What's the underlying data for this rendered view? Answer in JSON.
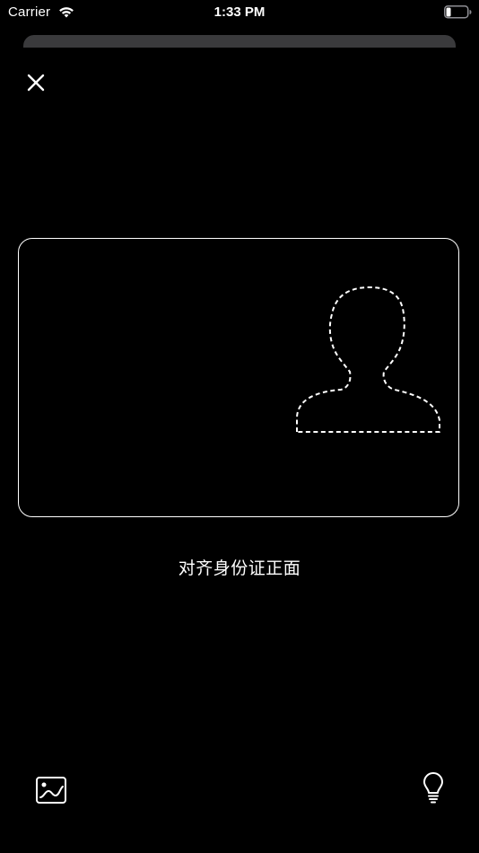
{
  "status_bar": {
    "carrier": "Carrier",
    "time": "1:33 PM",
    "wifi_icon": "wifi-icon",
    "battery_icon": "battery-icon"
  },
  "toolbar": {
    "close_icon": "close-icon"
  },
  "scanner": {
    "hint": "对齐身份证正面",
    "frame_color": "#ffffff",
    "portrait_icon": "portrait-outline-icon"
  },
  "bottom_bar": {
    "gallery_icon": "image-gallery-icon",
    "flash_icon": "lightbulb-icon"
  },
  "colors": {
    "background": "#000000",
    "foreground": "#ffffff",
    "sheet_handle": "#3a3a3c"
  }
}
